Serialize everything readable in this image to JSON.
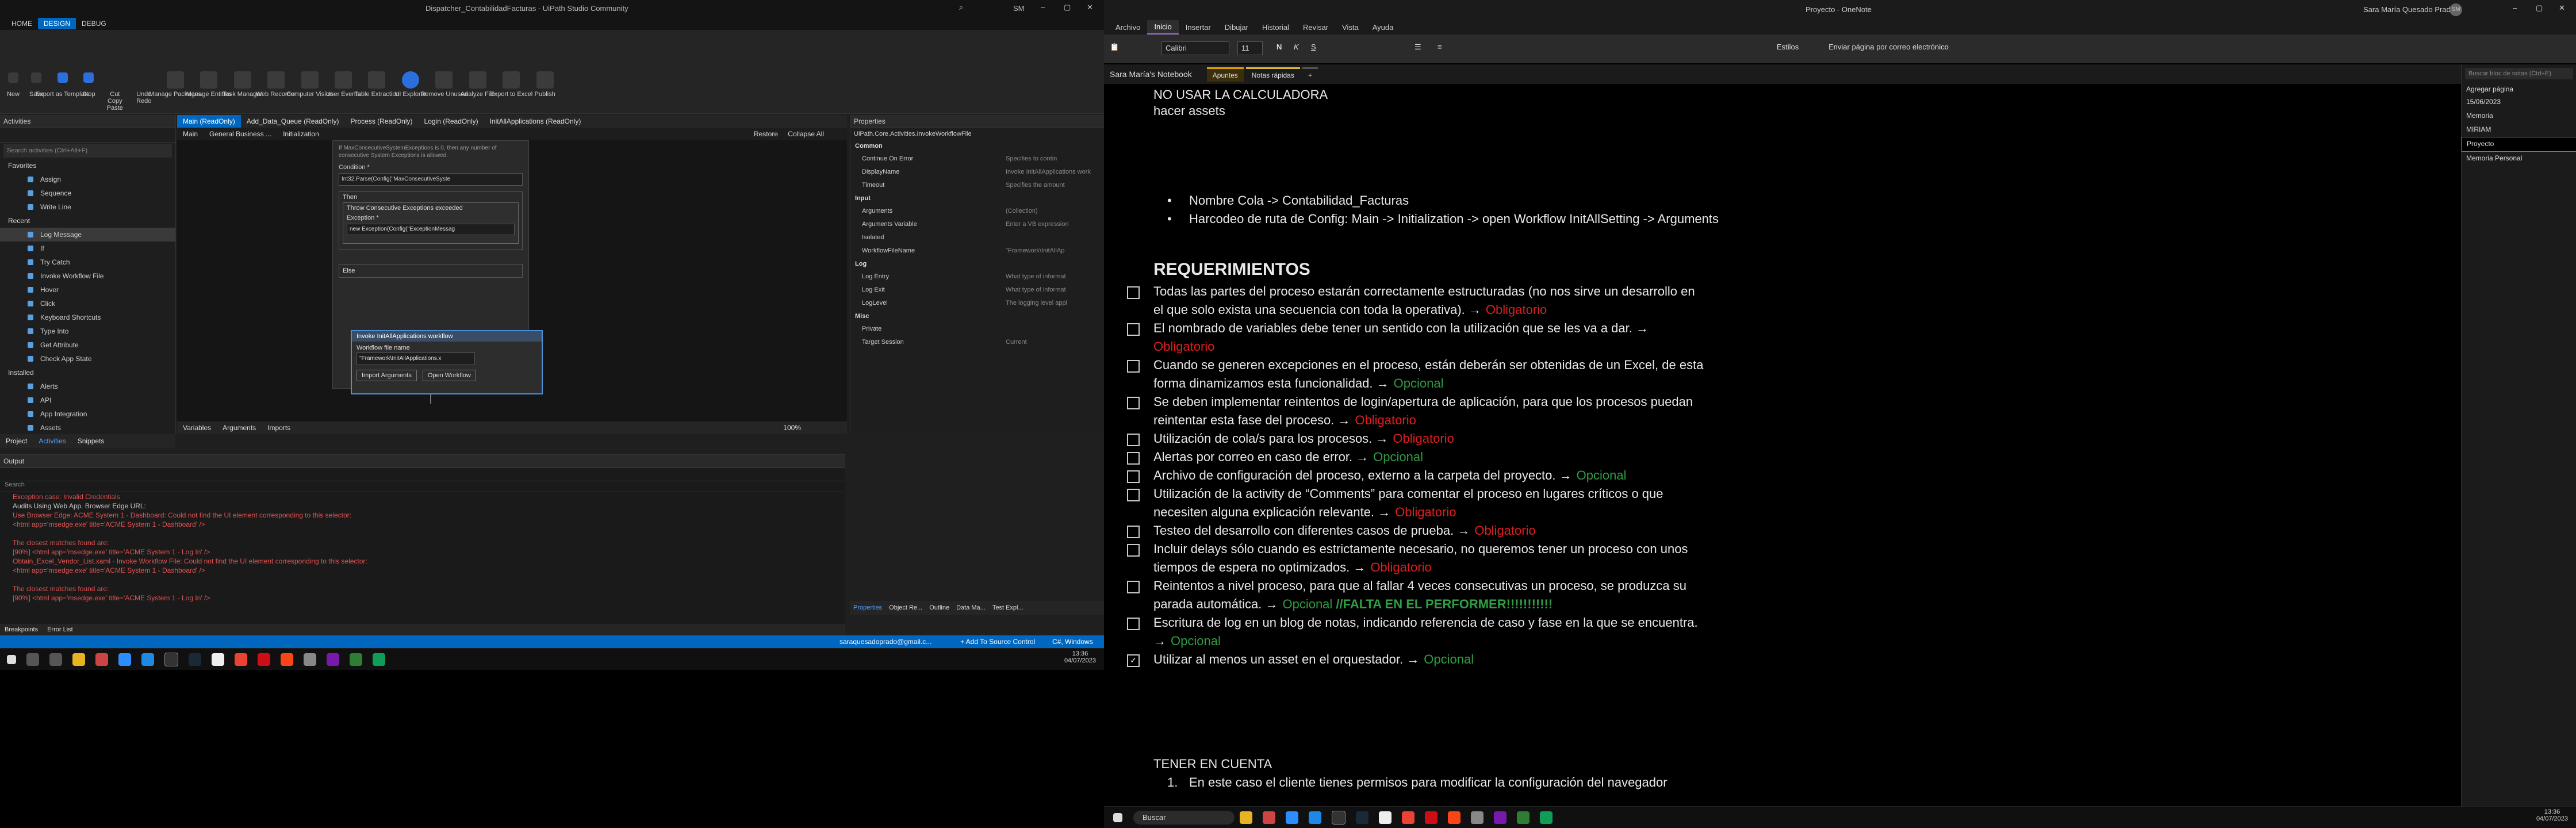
{
  "uipath": {
    "window_title": "Dispatcher_ContabilidadFacturas - UiPath Studio Community",
    "menu_tabs": [
      "HOME",
      "DESIGN",
      "DEBUG"
    ],
    "user_initials": "SM",
    "ribbon": [
      "New",
      "Save",
      "Export as Template",
      "Stop",
      "Cut",
      "Copy",
      "Paste",
      "Undo",
      "Redo",
      "Manage Packages",
      "Manage Entities",
      "Task Manager",
      "Web Recorder",
      "Computer Vision",
      "User Events",
      "Table Extraction",
      "UI Explorer",
      "Remove Unused",
      "Analyze File",
      "Export to Excel",
      "Publish"
    ],
    "activities_title": "Activities",
    "search_placeholder": "Search activities (Ctrl+Alt+F)",
    "activities": [
      {
        "label": "Favorites",
        "section": true
      },
      {
        "label": "Assign"
      },
      {
        "label": "Sequence"
      },
      {
        "label": "Write Line"
      },
      {
        "label": "Recent",
        "section": true
      },
      {
        "label": "Log Message",
        "selected": true
      },
      {
        "label": "If"
      },
      {
        "label": "Try Catch"
      },
      {
        "label": "Invoke Workflow File"
      },
      {
        "label": "Hover"
      },
      {
        "label": "Click"
      },
      {
        "label": "Keyboard Shortcuts"
      },
      {
        "label": "Type Into"
      },
      {
        "label": "Get Attribute"
      },
      {
        "label": "Check App State"
      },
      {
        "label": "Installed",
        "section": true
      },
      {
        "label": "Alerts"
      },
      {
        "label": "API"
      },
      {
        "label": "App Integration"
      },
      {
        "label": "Assets"
      }
    ],
    "left_bottom_tabs": [
      "Project",
      "Activities",
      "Snippets"
    ],
    "doc_tabs": [
      "Main (ReadOnly)",
      "Add_Data_Queue (ReadOnly)",
      "Process (ReadOnly)",
      "Login (ReadOnly)",
      "InitAllApplications (ReadOnly)"
    ],
    "breadcrumb": [
      "Main",
      "General Business ...",
      "Initialization"
    ],
    "restore": "Restore",
    "collapse_all": "Collapse All",
    "designer": {
      "note": "If MaxConsecutiveSystemExceptions is 0, then any number of consecutive System Exceptions is allowed.",
      "condition_label": "Condition *",
      "condition_value": "Int32.Parse(Config(\"MaxConsecutiveSyste",
      "then_label": "Then",
      "throw_label": "Throw Consecutive Exceptions exceeded",
      "exception_label": "Exception *",
      "exception_value": "new Exception(Config(\"ExceptionMessag",
      "else_label": "Else",
      "invoke_title": "Invoke InitAllApplications workflow",
      "wf_label": "Workflow file name",
      "wf_value": "\"Framework\\InitAllApplications.x",
      "import_btn": "Import Arguments",
      "open_btn": "Open Workflow"
    },
    "bottom_designer_tabs": [
      "Variables",
      "Arguments",
      "Imports"
    ],
    "zoom": "100%",
    "properties": {
      "title": "Properties",
      "activity": "UiPath.Core.Activities.InvokeWorkflowFile",
      "rows": [
        {
          "cat": "Common"
        },
        {
          "k": "Continue On Error",
          "v": "Specifies to contin"
        },
        {
          "k": "DisplayName",
          "v": "Invoke InitAllApplications work"
        },
        {
          "k": "Timeout",
          "v": "Specifies the amount"
        },
        {
          "cat": "Input"
        },
        {
          "k": "Arguments",
          "v": "(Collection)"
        },
        {
          "k": "Arguments Variable",
          "v": "Enter a VB expression"
        },
        {
          "k": "Isolated",
          "v": ""
        },
        {
          "k": "WorkflowFileName",
          "v": "\"Framework\\InitAllAp"
        },
        {
          "cat": "Log"
        },
        {
          "k": "Log Entry",
          "v": "What type of informat"
        },
        {
          "k": "Log Exit",
          "v": "What type of informat"
        },
        {
          "k": "LogLevel",
          "v": "The logging level appl"
        },
        {
          "cat": "Misc"
        },
        {
          "k": "Private",
          "v": ""
        },
        {
          "k": "Target Session",
          "v": "Current"
        }
      ],
      "bottom_tabs": [
        "Properties",
        "Object Re...",
        "Outline",
        "Data Ma...",
        "Test Expl..."
      ]
    },
    "output": {
      "title": "Output",
      "search": "Search",
      "lines": [
        {
          "t": "Exception case: Invalid Credentials",
          "w": false
        },
        {
          "t": "Audits Using Web App. Browser Edge URL:",
          "w": true
        },
        {
          "t": "Use Browser Edge: ACME System 1 - Dashboard: Could not find the UI element corresponding to this selector:",
          "w": false
        },
        {
          "t": "<html app='msedge.exe' title='ACME System 1 - Dashboard' />",
          "w": false
        },
        {
          "t": "",
          "w": false
        },
        {
          "t": "The closest matches found are:",
          "w": false
        },
        {
          "t": "[90%] <html app='msedge.exe' title='ACME System 1 - Log In' />",
          "w": false
        },
        {
          "t": "Obtain_Excel_Vendor_List.xaml - Invoke Workflow File: Could not find the UI element corresponding to this selector:",
          "w": false
        },
        {
          "t": "<html app='msedge.exe' title='ACME System 1 - Dashboard' />",
          "w": false
        },
        {
          "t": "",
          "w": false
        },
        {
          "t": "The closest matches found are:",
          "w": false
        },
        {
          "t": "[90%] <html app='msedge.exe' title='ACME System 1 - Log In' />",
          "w": false
        }
      ],
      "bottom_tabs": [
        "Breakpoints",
        "Error List"
      ]
    },
    "status": {
      "email": "saraquesadoprado@gmail.c...",
      "source_control": "+ Add To Source Control",
      "project": "C#, Windows"
    },
    "clock": {
      "time": "13:36",
      "date": "04/07/2023"
    }
  },
  "onenote": {
    "window_title": "Proyecto - OneNote",
    "user": "Sara María Quesado Prado",
    "avatar": "SM",
    "tabs": [
      "Archivo",
      "Inicio",
      "Insertar",
      "Dibujar",
      "Historial",
      "Revisar",
      "Vista",
      "Ayuda"
    ],
    "font_name": "Calibri",
    "font_size": "11",
    "styles_label": "Estilos",
    "email_label": "Enviar página por correo electrónico",
    "notebook": "Sara María's Notebook",
    "sections": [
      "Apuntes",
      "Notas rápidas",
      "+"
    ],
    "section_colors": [
      "#e0a000",
      "#d8b93a",
      "#555555"
    ],
    "search_placeholder": "Buscar bloc de notas (Ctrl+E)",
    "add_page": "Agregar página",
    "pages": [
      {
        "t": "15/06/2023",
        "sel": false
      },
      {
        "t": "Memoria",
        "sel": false
      },
      {
        "t": "MIRIAM",
        "sel": false
      },
      {
        "t": "Proyecto",
        "sel": true
      },
      {
        "t": "Memoria Personal",
        "sel": false
      }
    ],
    "note": {
      "l1": "NO USAR LA CALCULADORA",
      "l2": "hacer assets",
      "b1": "Nombre Cola -> Contabilidad_Facturas",
      "b2": "Harcodeo de ruta de Config: Main -> Initialization -> open Workflow InitAllSetting -> Arguments",
      "heading": "REQUERIMIENTOS",
      "reqs": [
        {
          "lines": [
            "Todas las partes del proceso estarán correctamente estructuradas (no nos sirve un desarrollo en",
            "el que solo exista una secuencia con toda la operativa). →"
          ],
          "tag": "Obligatorio",
          "tagcls": "red",
          "inline": true,
          "checked": false
        },
        {
          "lines": [
            "El nombrado de variables debe tener un sentido con la utilización que se les va a dar. →"
          ],
          "tag": "Obligatorio",
          "tagcls": "red",
          "inline": false,
          "checked": false
        },
        {
          "lines": [
            "Cuando se generen excepciones en el proceso, están deberán ser obtenidas de un Excel, de esta",
            "forma dinamizamos esta funcionalidad. →"
          ],
          "tag": "Opcional",
          "tagcls": "green",
          "inline": true,
          "checked": false
        },
        {
          "lines": [
            "Se deben implementar reintentos de login/apertura de aplicación, para que los procesos puedan",
            "reintentar esta fase del proceso. →"
          ],
          "tag": "Obligatorio",
          "tagcls": "red",
          "inline": true,
          "checked": false
        },
        {
          "lines": [
            "Utilización de cola/s para los procesos. →"
          ],
          "tag": "Obligatorio",
          "tagcls": "red",
          "inline": true,
          "checked": false
        },
        {
          "lines": [
            " Alertas por correo en caso de error. →"
          ],
          "tag": "Opcional",
          "tagcls": "green",
          "inline": true,
          "checked": false
        },
        {
          "lines": [
            " Archivo de configuración del proceso, externo a la carpeta del proyecto. →"
          ],
          "tag": "Opcional",
          "tagcls": "green",
          "inline": true,
          "checked": false
        },
        {
          "lines": [
            "Utilización de la activity de “Comments” para comentar el proceso en lugares críticos o que",
            "necesiten alguna explicación relevante. →"
          ],
          "tag": "Obligatorio",
          "tagcls": "red",
          "inline": true,
          "checked": false
        },
        {
          "lines": [
            "Testeo del desarrollo con diferentes casos de prueba. →"
          ],
          "tag": "Obligatorio",
          "tagcls": "red",
          "inline": true,
          "checked": false
        },
        {
          "lines": [
            "Incluir delays sólo cuando es estrictamente necesario, no queremos tener un proceso con unos",
            "tiempos de espera no optimizados. →"
          ],
          "tag": "Obligatorio",
          "tagcls": "red",
          "inline": true,
          "checked": false
        },
        {
          "lines": [
            "Reintentos a nivel proceso, para que al fallar 4 veces consecutivas un proceso, se produzca su",
            "parada automática. →"
          ],
          "tag": "Opcional",
          "tagcls": "green",
          "extra": " //FALTA EN EL PERFORMER!!!!!!!!!!!",
          "inline": true,
          "checked": false
        },
        {
          "lines": [
            "Escritura de log en un blog de notas, indicando referencia de caso y fase en la que se encuentra.",
            "→"
          ],
          "tag": "Opcional",
          "tagcls": "green",
          "inline": true,
          "checked": false
        },
        {
          "lines": [
            " Utilizar al menos un asset en el orquestador. →"
          ],
          "tag": "Opcional",
          "tagcls": "green",
          "inline": true,
          "checked": true
        }
      ],
      "h2": "TENER EN CUENTA",
      "n1_num": "1.",
      "n1": "En este caso el cliente tienes permisos para modificar la configuración del navegador"
    },
    "taskbar_search": "Buscar",
    "clock": {
      "time": "13:36",
      "date": "04/07/2023"
    }
  }
}
